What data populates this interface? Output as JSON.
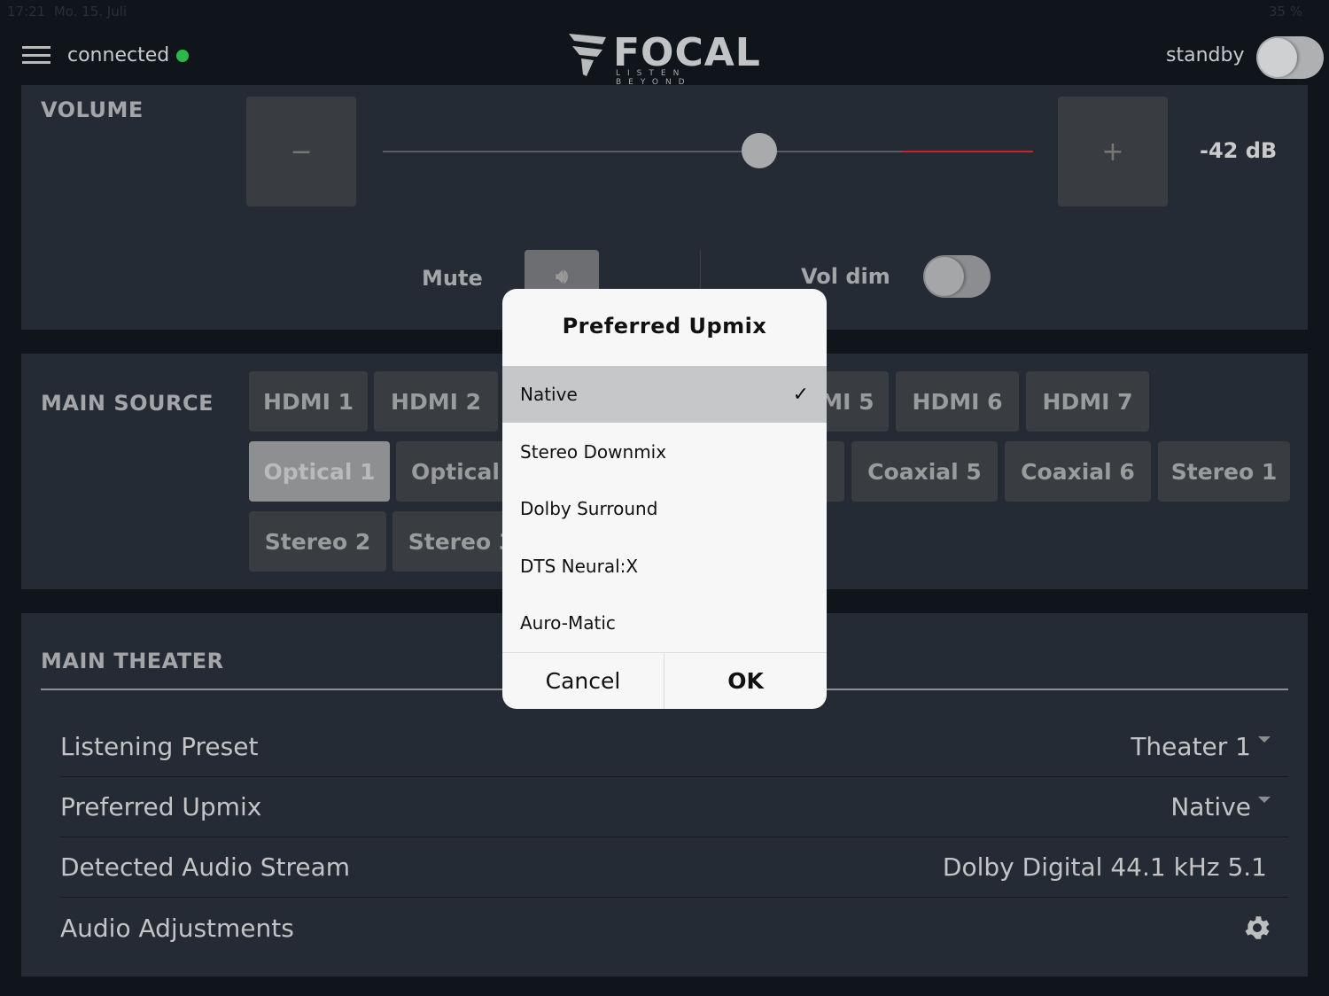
{
  "status_bar": {
    "time": "17:21",
    "date": "Mo. 15. Juli",
    "battery": "35 %"
  },
  "header": {
    "connection": "connected",
    "connection_color": "#2db84a",
    "brand": "FOCAL",
    "tagline": "LISTEN BEYOND",
    "standby_label": "standby",
    "standby_on": false
  },
  "volume": {
    "label": "VOLUME",
    "minus": "−",
    "plus": "+",
    "value_text": "-42 dB",
    "mute_label": "Mute",
    "voldim_label": "Vol dim",
    "voldim_on": false,
    "accent": "#c0272d"
  },
  "main_source": {
    "label": "MAIN SOURCE",
    "buttons": [
      "HDMI 1",
      "HDMI 2",
      "HDMI 5",
      "HDMI 6",
      "HDMI 7",
      "Optical 1",
      "Optical 2",
      "Coaxial 5",
      "Coaxial 6",
      "Stereo 1",
      "Stereo 2",
      "Stereo 3"
    ],
    "selected": "Optical 1"
  },
  "main_theater": {
    "label": "MAIN THEATER",
    "rows": [
      {
        "label": "Listening Preset",
        "value": "Theater 1"
      },
      {
        "label": "Preferred Upmix",
        "value": "Native"
      },
      {
        "label": "Detected Audio Stream",
        "value": "Dolby Digital 44.1 kHz 5.1"
      },
      {
        "label": "Audio Adjustments",
        "icon": "gear-icon"
      }
    ]
  },
  "dialog": {
    "title": "Preferred Upmix",
    "options": [
      "Native",
      "Stereo Downmix",
      "Dolby Surround",
      "DTS Neural:X",
      "Auro-Matic"
    ],
    "selected": "Native",
    "cancel": "Cancel",
    "ok": "OK"
  }
}
